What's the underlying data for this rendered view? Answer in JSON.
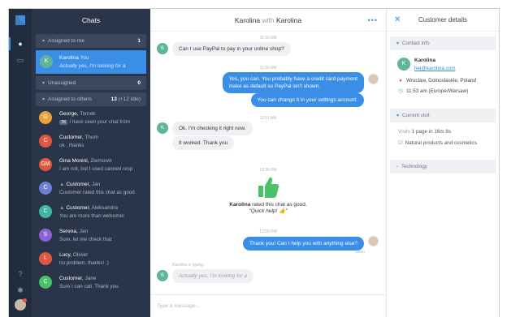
{
  "rail": {
    "icons": [
      "logo-icon",
      "chat-bubble-icon",
      "archive-icon",
      "help-icon",
      "settings-icon",
      "agent-avatar"
    ]
  },
  "chats": {
    "title": "Chats",
    "groups": {
      "assigned": {
        "label": "Assigned to me",
        "count": "1"
      },
      "unassigned": {
        "label": "Unassigned",
        "count": "0"
      },
      "others": {
        "label": "Assigned to others",
        "count": "13",
        "extra": "(+12 idle)"
      }
    },
    "selected": {
      "initial": "K",
      "name": "Karolina",
      "you": "You",
      "preview": "Actually yes, I'm looking for a"
    },
    "items": [
      {
        "initial": "G",
        "color": "#e8a33a",
        "name": "George",
        "agent": "Tomek",
        "badge": "TK",
        "preview": "I have seen your chat from"
      },
      {
        "initial": "C",
        "color": "#e0583f",
        "name": "Customer",
        "agent": "Thom",
        "badge": "",
        "preview": "ok , thanks"
      },
      {
        "initial": "GM",
        "color": "#e0583f",
        "name": "Gina Monini",
        "agent": "Ziemowit",
        "badge": "",
        "preview": "I am not, but I used canned resp"
      },
      {
        "initial": "C",
        "color": "#6f7fd8",
        "name": "Customer",
        "agent": "Jan",
        "badge": "",
        "preview": "Customer rated this chat as good"
      },
      {
        "initial": "C",
        "color": "#3fb8a3",
        "name": "Customer",
        "agent": "Aleksandra",
        "badge": "",
        "preview": "You are more than welcome!"
      },
      {
        "initial": "S",
        "color": "#8e62d6",
        "name": "Serena",
        "agent": "Jan",
        "badge": "",
        "preview": "Sure, let me check that"
      },
      {
        "initial": "L",
        "color": "#e0583f",
        "name": "Lucy",
        "agent": "Olivier",
        "badge": "",
        "preview": "no problem, thanks! :)"
      },
      {
        "initial": "C",
        "color": "#4bc16b",
        "name": "Customer",
        "agent": "Jane",
        "badge": "",
        "preview": "Sure I can call. Thank you"
      }
    ]
  },
  "conversation": {
    "title_a": "Karolina",
    "with": "with",
    "title_b": "Karolina",
    "avatar_initial": "K",
    "times": [
      "11:50 AM",
      "11:50 AM",
      "11:51 AM",
      "10:30 PM",
      "12:00 PM"
    ],
    "msg1": "Can I use PayPal to pay in your online shop?",
    "msg2a": "Yes, you can. You probably have a credit card payment",
    "msg2b": "make as default so PayPal isn't shown.",
    "msg3": "You can change it in your settings account.",
    "msg4": "Ok, I'm checking it right now.",
    "msg5": "It worked. Thank you",
    "rated_name": "Karolina",
    "rated_text": "rated this chat as good.",
    "rated_quote": "\"Quick help! 👍\"",
    "msg6": "Thank you! Can I help you with anything else?",
    "seen": "Seen",
    "typing_label": "Karolina is typing...",
    "typing_text": "Actually yes, I'm looking for a",
    "composer_placeholder": "Type a message..."
  },
  "details": {
    "title": "Customer details",
    "contact_info": "Contact info",
    "name": "Karolina",
    "email": "hej@karolina.com",
    "location": "Wroclaw, Dolnoslaskie, Poland",
    "time": "11:53 am (Europe/Warsaw)",
    "current_visit": "Current visit",
    "visits_label": "Visits",
    "visits_value": "1 page in 16m 8s",
    "page": "Natural products and cosmetics",
    "technology": "Technology"
  },
  "colors": {
    "accent": "#3a8ee6",
    "sidebar": "#2a3549",
    "rail": "#222c3f",
    "good": "#4bc16b"
  }
}
